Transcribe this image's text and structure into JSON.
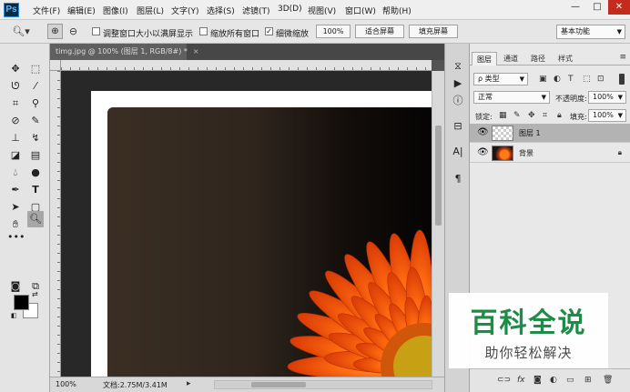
{
  "app": {
    "logo": "Ps",
    "menu": [
      "文件(F)",
      "编辑(E)",
      "图像(I)",
      "图层(L)",
      "文字(Y)",
      "选择(S)",
      "滤镜(T)",
      "3D(D)",
      "视图(V)",
      "窗口(W)",
      "帮助(H)"
    ],
    "window_controls": {
      "minimize": "—",
      "maximize": "□",
      "close": "✕"
    }
  },
  "options_bar": {
    "tool_icon": "zoom-icon",
    "resize_windows_label": "调整窗口大小以满屏显示",
    "resize_windows_checked": false,
    "zoom_all_label": "缩放所有窗口",
    "zoom_all_checked": false,
    "scrubby_zoom_label": "细微缩放",
    "scrubby_zoom_checked": true,
    "zoom_100_button": "100%",
    "fit_screen_button": "适合屏幕",
    "fill_screen_button": "填充屏幕",
    "workspace": "基本功能"
  },
  "document": {
    "tab_title": "timg.jpg @ 100% (图层 1, RGB/8#) *",
    "tab_close": "×",
    "zoom": "100%",
    "doc_size": "文档:2.75M/3.41M",
    "status_arrow": "▸"
  },
  "colors": {
    "foreground": "#000000",
    "background": "#ffffff",
    "flower_orange": "#ff6a10",
    "flower_center": "#c8a014"
  },
  "layers_panel": {
    "tabs": [
      "图层",
      "通道",
      "路径",
      "样式"
    ],
    "active_tab": "图层",
    "filter_type": "ρ 类型",
    "blend_mode": "正常",
    "opacity_label": "不透明度:",
    "opacity_value": "100%",
    "lock_label": "锁定:",
    "fill_label": "填充:",
    "fill_value": "100%",
    "layers": [
      {
        "name": "图层 1",
        "visible": true,
        "selected": true,
        "locked": false,
        "thumb": "transparent"
      },
      {
        "name": "背景",
        "visible": true,
        "selected": false,
        "locked": true,
        "thumb": "photo"
      }
    ]
  },
  "watermark": {
    "title": "百科全说",
    "subtitle": "助你轻松解决"
  }
}
